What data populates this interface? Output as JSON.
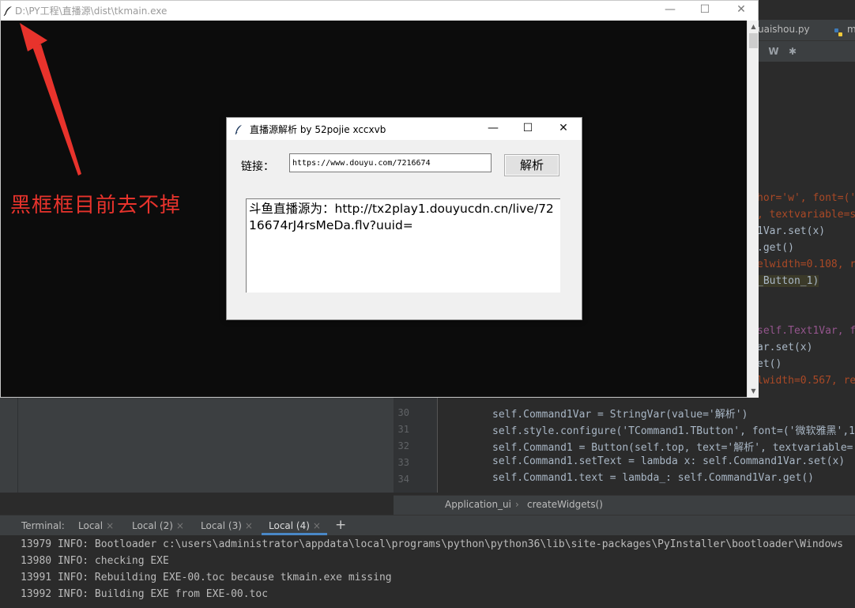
{
  "ide": {
    "tabs": [
      {
        "label": "uaishou.py"
      },
      {
        "label": "m"
      }
    ],
    "toolbar": {
      "w_label": "W"
    },
    "code_right_fragments": [
      {
        "text": "hor='w', font=('"
      },
      {
        "text": ", textvariable=s"
      },
      {
        "text": "1Var.set(x)"
      },
      {
        "text": ".get()"
      },
      {
        "text": "elwidth=0.108, r"
      },
      {
        "text": "_Button_1)"
      },
      {
        "text": "self.Text1Var, f"
      },
      {
        "text": "ar.set(x)"
      },
      {
        "text": "et()"
      },
      {
        "text": "lwidth=0.567, re"
      }
    ],
    "code_lines": [
      {
        "ln": "30",
        "text": "self.Command1Var = StringVar(value='解析')"
      },
      {
        "ln": "31",
        "text": "self.style.configure('TCommand1.TButton', font=('微软雅黑',1"
      },
      {
        "ln": "32",
        "text": "self.Command1 = Button(self.top, text='解析', textvariable="
      },
      {
        "ln": "33",
        "text": "self.Command1.setText = lambda x: self.Command1Var.set(x)"
      },
      {
        "ln": "34",
        "text": "self.Command1.text = lambda_: self.Command1Var.get()"
      }
    ],
    "breadcrumb": {
      "class_name": "Application_ui",
      "separator": "›",
      "method": "createWidgets()"
    },
    "terminal": {
      "label": "Terminal:",
      "tabs": [
        {
          "label": "Local"
        },
        {
          "label": "Local (2)"
        },
        {
          "label": "Local (3)"
        },
        {
          "label": "Local (4)"
        }
      ],
      "add_label": "+",
      "lines": [
        {
          "text": "13979 INFO: Bootloader c:\\users\\administrator\\appdata\\local\\programs\\python\\python36\\lib\\site-packages\\PyInstaller\\bootloader\\Windows"
        },
        {
          "text": "13980 INFO: checking EXE"
        },
        {
          "text": "13991 INFO: Rebuilding EXE-00.toc because tkmain.exe missing"
        },
        {
          "text": "13992 INFO: Building EXE from EXE-00.toc"
        }
      ]
    }
  },
  "console": {
    "title": "D:\\PY工程\\直播源\\dist\\tkmain.exe",
    "annotation": "黑框框目前去不掉",
    "controls": {
      "minimize": "—",
      "maximize": "☐",
      "close": "✕"
    }
  },
  "dialog": {
    "title": "直播源解析 by 52pojie xccxvb",
    "link_label": "链接：",
    "url_value": "https://www.douyu.com/7216674",
    "parse_button": "解析",
    "result_text": "斗鱼直播源为：http://tx2play1.douyucdn.cn/live/7216674rJ4rsMeDa.flv?uuid=",
    "controls": {
      "minimize": "—",
      "maximize": "☐",
      "close": "✕"
    }
  },
  "colors": {
    "annotation_red": "#e8332c",
    "console_bg": "#0c0c0c",
    "ide_bg": "#2b2b2b"
  }
}
